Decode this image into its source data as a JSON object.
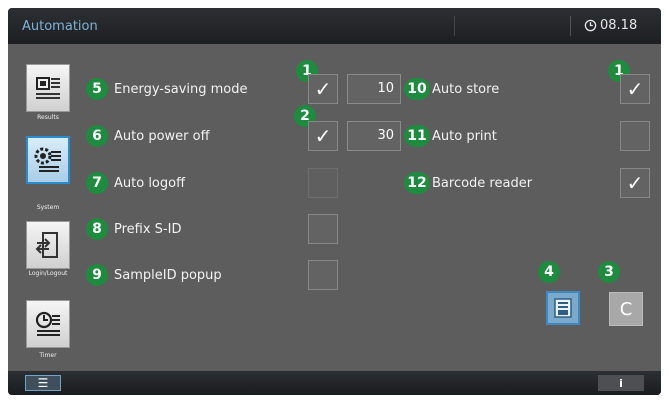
{
  "window": {
    "title": "Automation",
    "time": "08.18"
  },
  "sidebar": [
    {
      "label": "Results",
      "icon": "results-icon"
    },
    {
      "label": "System",
      "icon": "system-icon"
    },
    {
      "label": "Login/Logout",
      "icon": "login-logout-icon"
    },
    {
      "label": "Timer",
      "icon": "timer-icon"
    }
  ],
  "callouts": {
    "left_1": "1",
    "left_2": "2",
    "right_1": "1",
    "save": "4",
    "clear": "3"
  },
  "options_left": [
    {
      "num": "5",
      "label": "Energy-saving mode",
      "checked": true,
      "value": "10"
    },
    {
      "num": "6",
      "label": "Auto power off",
      "checked": true,
      "value": "30"
    },
    {
      "num": "7",
      "label": "Auto logoff",
      "checked": false
    },
    {
      "num": "8",
      "label": "Prefix S-ID",
      "checked": false
    },
    {
      "num": "9",
      "label": "SampleID popup",
      "checked": false
    }
  ],
  "options_right": [
    {
      "num": "10",
      "label": "Auto store",
      "checked": true
    },
    {
      "num": "11",
      "label": "Auto print",
      "checked": false
    },
    {
      "num": "12",
      "label": "Barcode reader",
      "checked": true
    }
  ],
  "check_glyph": "✓",
  "buttons": {
    "clear": "C",
    "menu": "☰",
    "info": "i"
  },
  "colors": {
    "badge": "#1d8c3e",
    "accent": "#2a8ccf"
  }
}
